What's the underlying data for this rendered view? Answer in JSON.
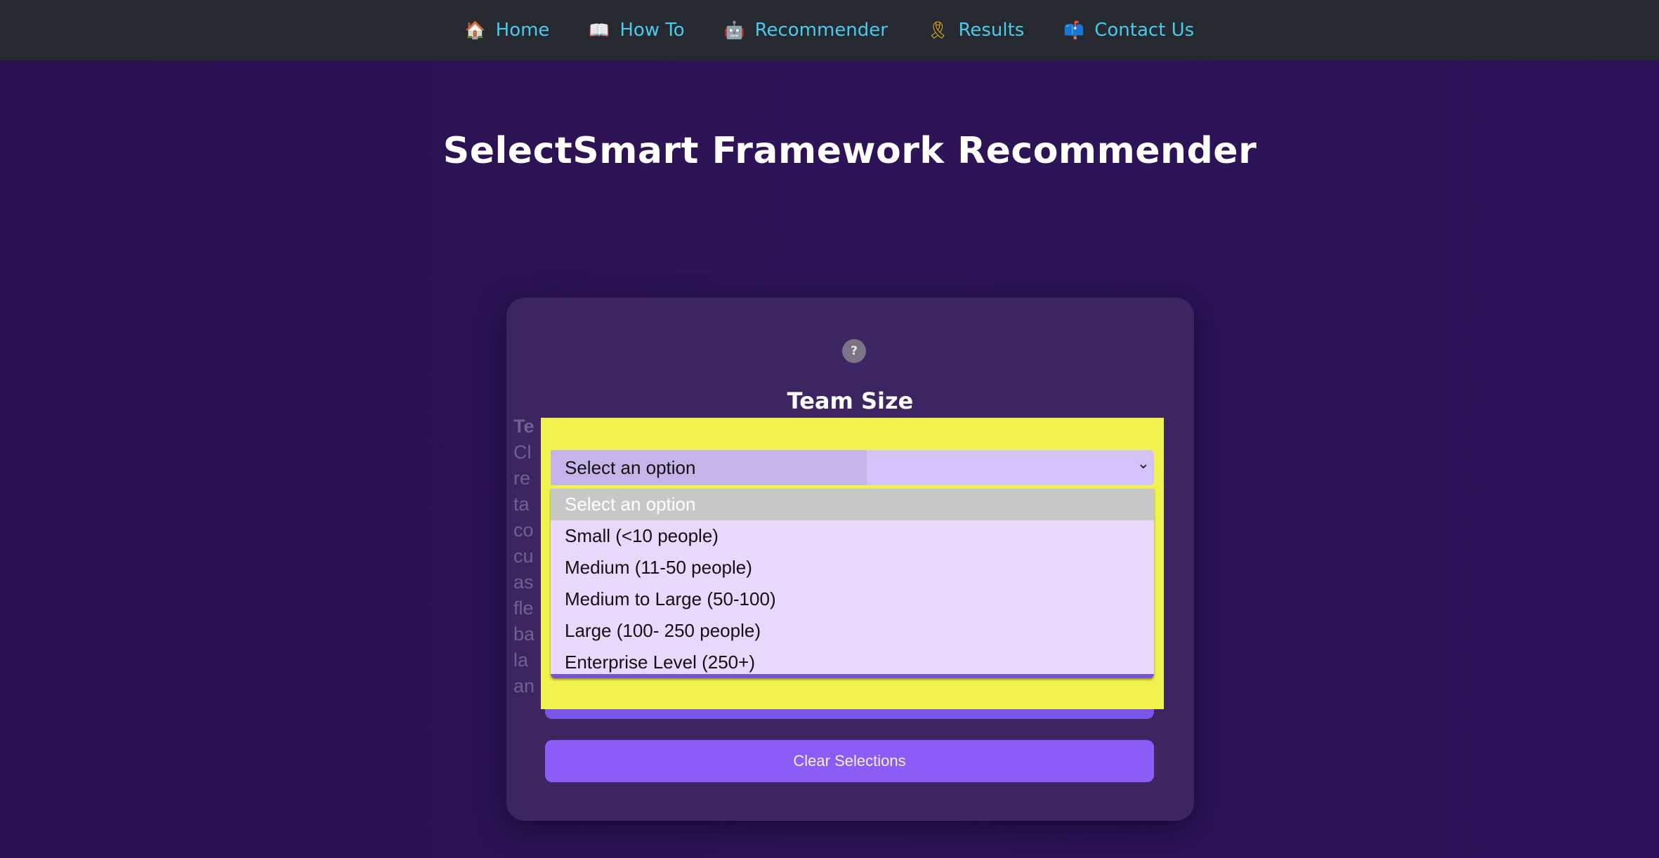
{
  "nav": {
    "items": [
      {
        "icon": "house-icon",
        "glyph": "🏠",
        "label": "Home"
      },
      {
        "icon": "open-book-icon",
        "glyph": "📖",
        "label": "How To"
      },
      {
        "icon": "robot-icon",
        "glyph": "🤖",
        "label": "Recommender"
      },
      {
        "icon": "ribbon-icon",
        "glyph": "🎗",
        "label": "Results"
      },
      {
        "icon": "mailbox-icon",
        "glyph": "📫",
        "label": "Contact Us"
      }
    ]
  },
  "page": {
    "title": "SelectSmart Framework Recommender"
  },
  "card": {
    "help_icon": "?",
    "question": "Team Size",
    "tooltip_lines": [
      "Te",
      "Cl",
      "re",
      "ta",
      "co",
      "cu",
      "as",
      "fle",
      "ba",
      "la",
      "an"
    ],
    "select": {
      "value": "Select an option",
      "chevron": "⌄",
      "options": [
        "Select an option",
        "Small (<10 people)",
        "Medium (11-50 people)",
        "Medium to Large (50-100)",
        "Large (100- 250 people)",
        "Enterprise Level (250+)"
      ],
      "selected_index": 0
    },
    "clear_button_label": "Clear Selections"
  },
  "colors": {
    "navbar_bg": "#262a30",
    "nav_link": "#4cc9e8",
    "card_bg": "#3c2560",
    "highlight": "#f2f24f",
    "button": "#8b5cf6"
  }
}
